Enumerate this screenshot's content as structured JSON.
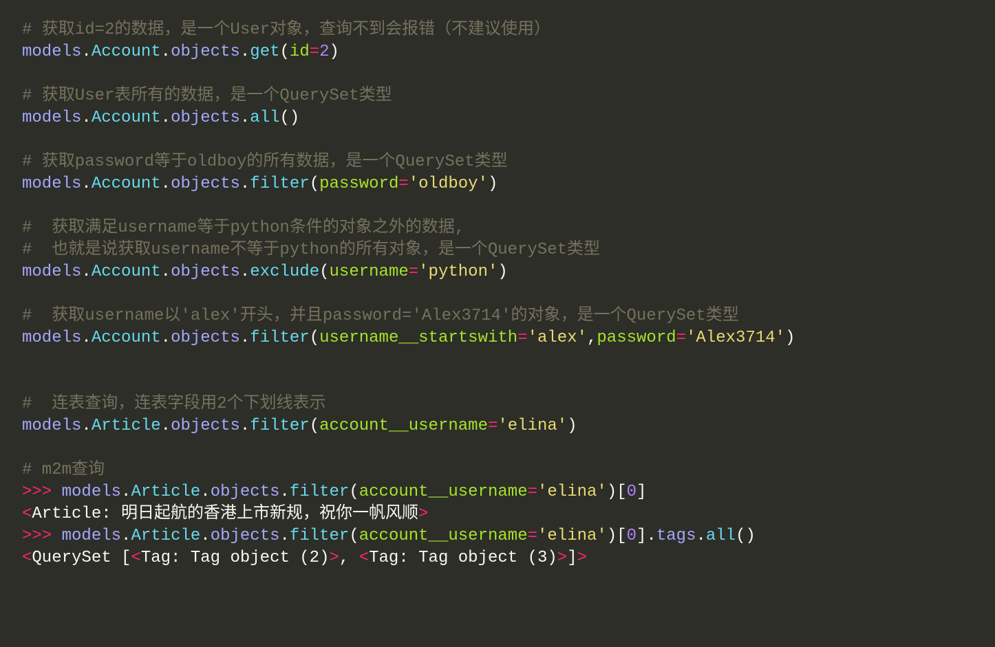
{
  "lines": [
    "# 获取id=2的数据，是一个User对象，查询不到会报错（不建议使用）",
    "# 获取User表所有的数据，是一个QuerySet类型",
    "# 获取password等于oldboy的所有数据，是一个QuerySet类型",
    "#  获取满足username等于python条件的对象之外的数据,",
    "#  也就是说获取username不等于python的所有对象，是一个QuerySet类型",
    "#  获取username以'alex'开头，并且password='Alex3714'的对象，是一个QuerySet类型",
    "#  连表查询，连表字段用2个下划线表示",
    "# m2m查询"
  ],
  "t": {
    "models": "models",
    "Account": "Account",
    "Article": "Article",
    "objects": "objects",
    "get": "get",
    "all": "all",
    "filter": "filter",
    "exclude": "exclude",
    "tags": "tags",
    "id": "id",
    "password": "password",
    "username": "username",
    "username_startswith": "username__startswith",
    "account_username": "account__username",
    "eq": "=",
    "two": "2",
    "zero": "0",
    "oldboy": "'oldboy'",
    "python": "'python'",
    "alex": "'alex'",
    "Alex3714": "'Alex3714'",
    "elina": "'elina'",
    "prompt": ">>>",
    "lt": "<",
    "gt": ">",
    "article_repr": "Article: 明日起航的香港上市新规，祝你一帆风顺",
    "qs1": "QuerySet [",
    "tag2": "Tag: Tag object (2)",
    "comma_sp": ", ",
    "tag3": "Tag: Tag object (3)",
    "close_br": "]"
  }
}
